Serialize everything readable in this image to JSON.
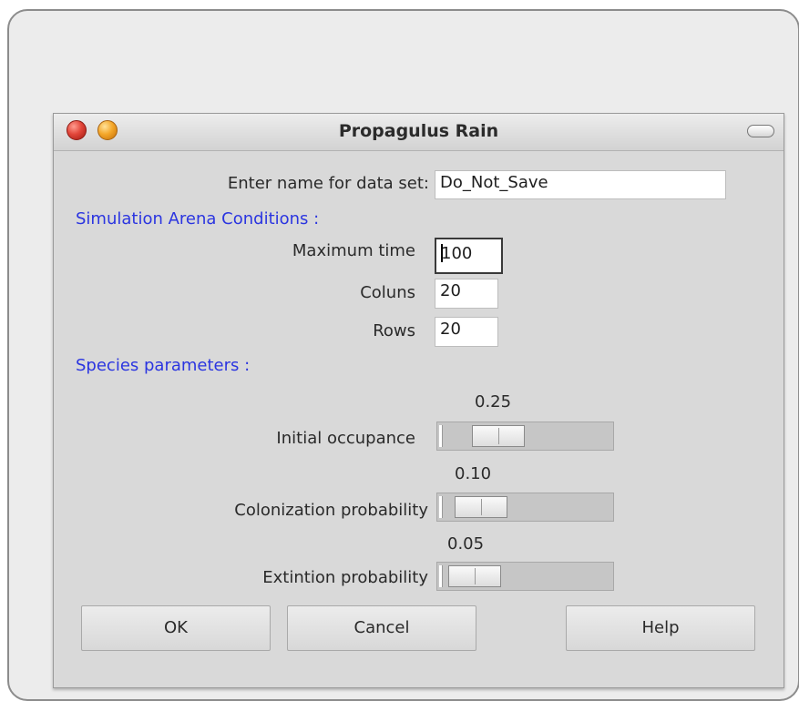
{
  "window": {
    "title": "Propagulus Rain"
  },
  "dataset": {
    "label": "Enter name for data set:",
    "value": "Do_Not_Save"
  },
  "arena": {
    "section_label": "Simulation Arena Conditions :",
    "max_time_label": "Maximum time",
    "max_time_value": "100",
    "columns_label": "Coluns",
    "columns_value": "20",
    "rows_label": "Rows",
    "rows_value": "20"
  },
  "species": {
    "section_label": "Species parameters :",
    "initial_occupance": {
      "label": "Initial occupance",
      "value_text": "0.25",
      "value": 0.25
    },
    "colonization_probability": {
      "label": "Colonization probability",
      "value_text": "0.10",
      "value": 0.1
    },
    "extinction_probability": {
      "label": "Extintion probability",
      "value_text": "0.05",
      "value": 0.05
    }
  },
  "buttons": {
    "ok": "OK",
    "cancel": "Cancel",
    "help": "Help"
  },
  "colors": {
    "section_text": "#2b35e0",
    "dialog_background": "#d9d9d9",
    "close_button": "#e2463a",
    "minimize_button": "#f4a72a"
  },
  "icons": {
    "close": "close-icon",
    "minimize": "minimize-icon",
    "zoom": "zoom-pill-icon"
  }
}
